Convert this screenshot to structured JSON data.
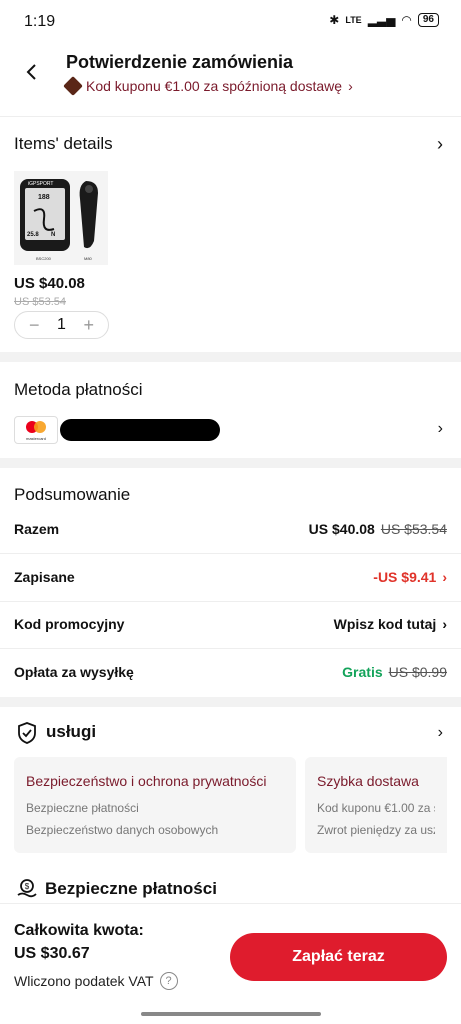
{
  "status": {
    "time": "1:19",
    "battery": "96",
    "network": "LTE"
  },
  "header": {
    "title": "Potwierdzenie zamówienia",
    "coupon_text": "Kod kuponu €1.00 za spóźnioną dostawę",
    "coupon_chevron": "›"
  },
  "items": {
    "title": "Items' details",
    "chevron": "›",
    "product": {
      "price": "US $40.08",
      "old_price": "US $53.54",
      "quantity": "1",
      "minus": "−",
      "plus": "+",
      "screen_brand": "iGPSPORT",
      "screen_numbers": [
        "188",
        "25.8",
        "N"
      ],
      "model_left": "BSC200",
      "model_right": "M80"
    }
  },
  "payment": {
    "title": "Metoda płatności",
    "card_brand": "mastercard",
    "chevron": "›"
  },
  "summary": {
    "title": "Podsumowanie",
    "rows": [
      {
        "label": "Razem",
        "value": "US $40.08",
        "old": "US $53.54"
      },
      {
        "label": "Zapisane",
        "value": "-US $9.41",
        "chevron": "›"
      },
      {
        "label": "Kod promocyjny",
        "value": "Wpisz kod tutaj",
        "chevron": "›"
      },
      {
        "label": "Opłata za wysyłkę",
        "value": "Gratis",
        "old": "US $0.99"
      }
    ]
  },
  "services": {
    "title": "usługi",
    "chevron": "›",
    "cards": [
      {
        "title": "Bezpieczeństwo i ochrona prywatności",
        "lines": [
          "Bezpieczne płatności",
          "Bezpieczeństwo danych osobowych"
        ]
      },
      {
        "title": "Szybka dostawa",
        "lines": [
          "Kod kuponu €1.00 za s",
          "Zwrot pieniędzy za uszl"
        ]
      }
    ]
  },
  "secure": {
    "title": "Bezpieczne płatności"
  },
  "footer": {
    "total_label": "Całkowita kwota:",
    "total_value": "US $30.67",
    "vat": "Wliczono podatek VAT",
    "help": "?",
    "pay_button": "Zapłać teraz"
  },
  "colors": {
    "accent": "#df1c2d",
    "brand_dark": "#7a1a2b",
    "green": "#13a35a",
    "red": "#e0332a"
  }
}
